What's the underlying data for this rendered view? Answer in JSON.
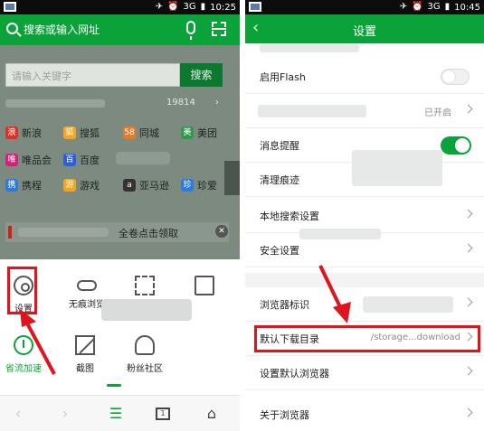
{
  "left": {
    "status_bar": {
      "time": "10:25",
      "network": "3G"
    },
    "search": {
      "placeholder": "搜索或输入网址"
    },
    "page": {
      "keyword_placeholder": "请输入关键字",
      "search_button": "搜索",
      "hot_count": "19814",
      "sites": [
        {
          "name": "新浪",
          "icon": "sina-icon",
          "color": "#d8322b"
        },
        {
          "name": "搜狐",
          "icon": "sohu-icon",
          "color": "#f5a623"
        },
        {
          "name": "同城",
          "icon": "58tongcheng-icon",
          "color": "#e8782a"
        },
        {
          "name": "美团",
          "icon": "meituan-icon",
          "color": "#2f9b4a"
        },
        {
          "name": "唯品会",
          "icon": "vip-icon",
          "color": "#d0237a"
        },
        {
          "name": "百度",
          "icon": "baidu-icon",
          "color": "#2d5fd6"
        },
        {
          "name": "携程",
          "icon": "ctrip-icon",
          "color": "#3079d8"
        },
        {
          "name": "游戏",
          "icon": "game-icon",
          "color": "#f2a621"
        },
        {
          "name": "亚马逊",
          "icon": "amazon-icon",
          "color": "#333333"
        },
        {
          "name": "珍爱",
          "icon": "zhenai-icon",
          "color": "#2f7ae0"
        }
      ],
      "banner_text": "全卷点击领取",
      "banner_close": "✕"
    },
    "menu": {
      "items": [
        {
          "label": "设置",
          "icon": "gear-icon"
        },
        {
          "label": "无痕浏览",
          "icon": "incognito-icon"
        },
        {
          "label": "",
          "icon": "fullscreen-icon"
        },
        {
          "label": "",
          "icon": "image-mode-icon"
        },
        {
          "label": "省流加速",
          "icon": "speed-icon"
        },
        {
          "label": "截图",
          "icon": "screenshot-icon"
        },
        {
          "label": "粉丝社区",
          "icon": "fans-icon"
        }
      ]
    },
    "bottom_nav": {
      "back": "‹",
      "forward": "›",
      "menu": "☰",
      "windows": "1",
      "home": "⌂"
    }
  },
  "right": {
    "status_bar": {
      "time": "10:45",
      "network": "3G"
    },
    "header": {
      "title": "设置",
      "back": "‹"
    },
    "rows": [
      {
        "label": "启用Flash",
        "control": "toggle-off"
      },
      {
        "label": "",
        "value": "已开启",
        "control": "chevron"
      },
      {
        "label": "消息提醒",
        "control": "toggle-on"
      },
      {
        "label": "清理痕迹",
        "control": "none"
      },
      {
        "label": "本地搜索设置",
        "control": "chevron"
      },
      {
        "label": "安全设置",
        "control": "chevron"
      },
      {
        "label": "浏览器标识",
        "control": "chevron"
      },
      {
        "label": "默认下载目录",
        "value": "/storage...download",
        "control": "chevron"
      },
      {
        "label": "设置默认浏览器",
        "control": "chevron"
      },
      {
        "label": "关于浏览器",
        "control": "chevron"
      }
    ]
  },
  "colors": {
    "accent": "#0aa33a",
    "highlight": "#e0141c"
  }
}
